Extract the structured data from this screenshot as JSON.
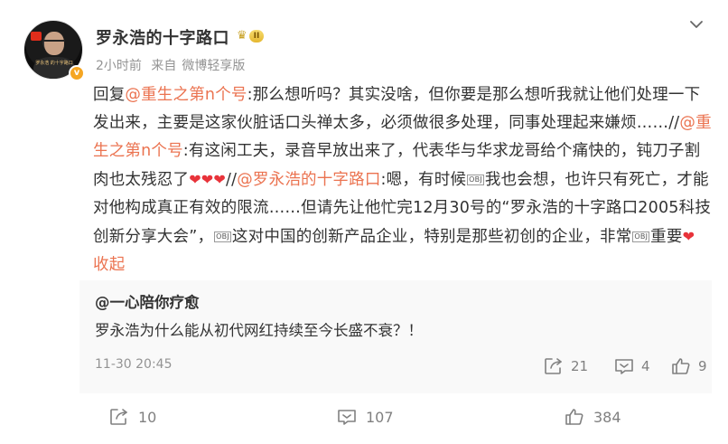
{
  "post": {
    "author": "罗永浩的十字路口",
    "level_label": "II",
    "time": "2小时前",
    "source_prefix": "来自",
    "source": "微博轻享版",
    "avatar_caption": "罗永浩 的十字路口",
    "verified_mark": "v",
    "content": {
      "p1": "回复",
      "m1": "@重生之第n个号",
      "p2": ":那么想听吗？其实没啥，但你要是那么想听我就让他们处理一下发出来，主要是这家伙脏话口头禅太多，必须做很多处理，同事处理起来嫌烦……//",
      "m2": "@重生之第n个号",
      "p3": ":有这闲工夫，录音早放出来了，代表华与华求龙哥给个痛快的，钝刀子割肉也太残忍了",
      "hearts": "❤❤❤",
      "p4": "//",
      "m3": "@罗永浩的十字路口",
      "p5": ":嗯，有时候",
      "obj1": "OBJ",
      "p6": "我也会想，也许只有死亡，才能对他构成真正有效的限流……但请先让他忙完12月30号的“罗永浩的十字路口2005科技创新分享大会”，",
      "obj2": "OBJ",
      "p7": "这对中国的创新产品企业，特别是那些初创的企业，非常",
      "obj3": "OBJ",
      "p8": "重要",
      "heart_end": "❤",
      "collapse": "收起"
    }
  },
  "comment": {
    "author": "@一心陪你疗愈",
    "text": "罗永浩为什么能从初代网红持续至今长盛不衰？！",
    "time": "11-30 20:45",
    "reposts": "21",
    "replies": "4",
    "likes": "9"
  },
  "actions": {
    "reposts": "10",
    "comments": "107",
    "likes": "384"
  },
  "colors": {
    "mention": "#eb7350",
    "heart": "#e8333a",
    "meta_gray": "#939393",
    "comment_bg": "#f9f9f9"
  },
  "icons": [
    "chevron-down-icon",
    "repost-icon",
    "comment-icon",
    "like-icon",
    "crown-icon",
    "verified-icon"
  ]
}
